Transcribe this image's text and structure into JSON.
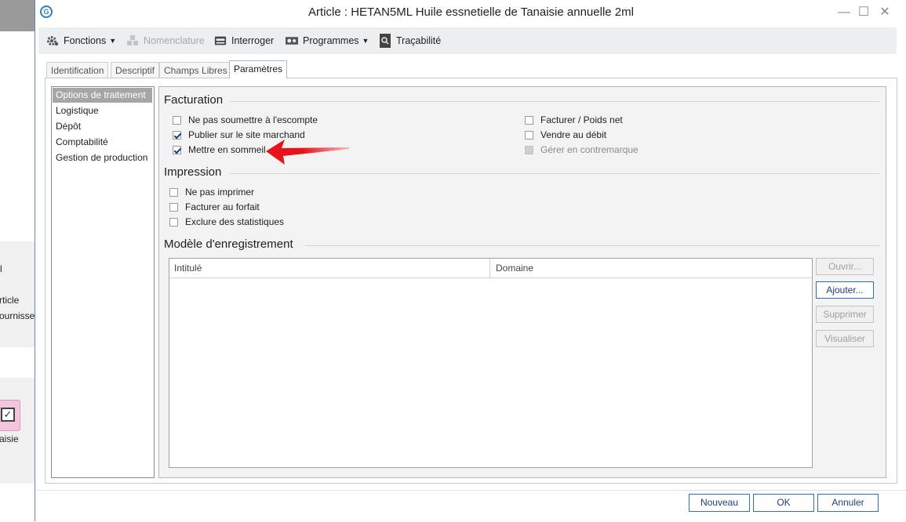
{
  "background_app": {
    "snippets": [
      "l",
      "rticle",
      "ournisse",
      "aisie"
    ]
  },
  "window": {
    "title": "Article : HETAN5ML Huile essnetielle de Tanaisie annuelle 2ml",
    "controls": {
      "minimize": "—",
      "maximize": "☐",
      "close": "✕"
    }
  },
  "toolbar": {
    "fonctions": "Fonctions",
    "nomenclature": "Nomenclature",
    "interroger": "Interroger",
    "programmes": "Programmes",
    "tracabilite": "Traçabilité"
  },
  "tabs": [
    "Identification",
    "Descriptif",
    "Champs Libres",
    "Paramètres"
  ],
  "active_tab": "Paramètres",
  "nav": {
    "items": [
      "Options de traitement",
      "Logistique",
      "Dépôt",
      "Comptabilité",
      "Gestion de production"
    ],
    "selected": "Options de traitement"
  },
  "facturation": {
    "title": "Facturation",
    "left": [
      {
        "label": "Ne pas soumettre à l'escompte",
        "checked": false
      },
      {
        "label": "Publier sur le site marchand",
        "checked": true
      },
      {
        "label": "Mettre en sommeil",
        "checked": true
      }
    ],
    "right": [
      {
        "label": "Facturer / Poids net",
        "checked": false
      },
      {
        "label": "Vendre au débit",
        "checked": false
      },
      {
        "label": "Gérer en contremarque",
        "checked": false,
        "disabled": true
      }
    ]
  },
  "impression": {
    "title": "Impression",
    "items": [
      {
        "label": "Ne pas imprimer",
        "checked": false
      },
      {
        "label": "Facturer au forfait",
        "checked": false
      },
      {
        "label": "Exclure des statistiques",
        "checked": false
      }
    ]
  },
  "modele": {
    "title": "Modèle d'enregistrement",
    "columns": [
      "Intitulé",
      "Domaine"
    ],
    "rows": []
  },
  "side_buttons": {
    "ouvrir": "Ouvrir...",
    "ajouter": "Ajouter...",
    "supprimer": "Supprimer",
    "visualiser": "Visualiser"
  },
  "footer": {
    "nouveau": "Nouveau",
    "ok": "OK",
    "annuler": "Annuler"
  },
  "colors": {
    "accent_border": "#2f6db5",
    "annotation_arrow": "#e8141b",
    "nav_selected": "#a6a6a6"
  }
}
